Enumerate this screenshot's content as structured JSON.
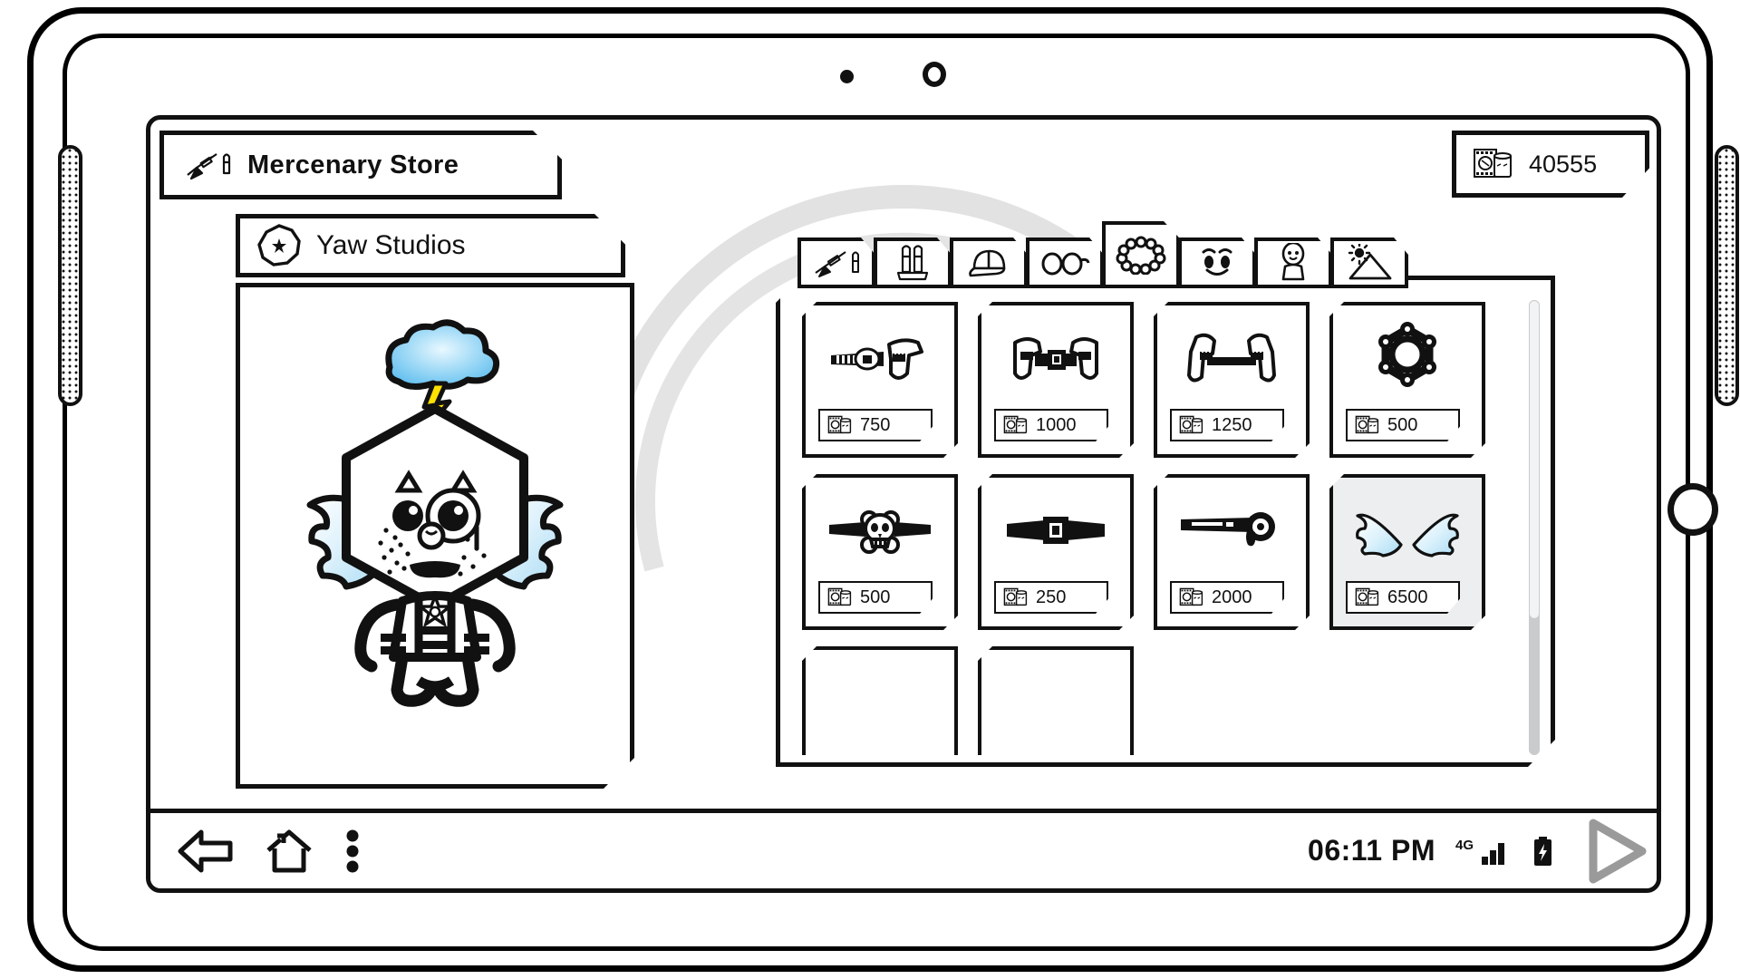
{
  "device": {
    "type": "tablet",
    "front_camera_icon": "camera-ring",
    "front_sensor_icon": "sensor-dot",
    "speaker_icon": "speaker-grille",
    "home_button_icon": "home-button-circle"
  },
  "header": {
    "title": "Mercenary Store",
    "title_icon": "rifle-bullet-icon",
    "currency": {
      "amount": "40555",
      "icon": "film-canister-icon"
    }
  },
  "studio": {
    "name": "Yaw Studios",
    "badge_icon": "nonagon-star-icon"
  },
  "character": {
    "name": "player-avatar",
    "head_shape": "hexagon",
    "mood_icon": "storm-cloud-lightning-icon",
    "eyewear": "monocle",
    "wings": "angel-wings",
    "chest_badge": "sheriff-star",
    "colors": {
      "cloud_fill": "#8fd4f5",
      "cloud_highlight": "#d8f1fd",
      "lightning": "#ffe000",
      "wing_fill": "#d9f1fc",
      "outline": "#111111"
    }
  },
  "tabs": [
    {
      "id": "weapons",
      "icon": "rifle-bullet-icon",
      "active": false
    },
    {
      "id": "ammo",
      "icon": "bullets-icon",
      "active": false
    },
    {
      "id": "headwear",
      "icon": "cap-icon",
      "active": false
    },
    {
      "id": "eyewear",
      "icon": "glasses-icon",
      "active": false
    },
    {
      "id": "accessories",
      "icon": "beads-necklace-icon",
      "active": true
    },
    {
      "id": "face",
      "icon": "face-icon",
      "active": false
    },
    {
      "id": "body",
      "icon": "body-icon",
      "active": false
    },
    {
      "id": "scenery",
      "icon": "landscape-sun-icon",
      "active": false
    }
  ],
  "store": {
    "currency_icon": "film-canister-icon",
    "scroll": {
      "thumb_percent": 70
    },
    "items": [
      {
        "id": "item-1",
        "icon": "holster-belt-single-icon",
        "price": "750",
        "selected": false
      },
      {
        "id": "item-2",
        "icon": "holster-belt-dual-icon",
        "price": "1000",
        "selected": false
      },
      {
        "id": "item-3",
        "icon": "holster-belt-cross-icon",
        "price": "1250",
        "selected": false
      },
      {
        "id": "item-4",
        "icon": "sheriff-star-badge-icon",
        "price": "500",
        "selected": false
      },
      {
        "id": "item-5",
        "icon": "skull-belt-icon",
        "price": "500",
        "selected": false
      },
      {
        "id": "item-6",
        "icon": "plain-belt-icon",
        "price": "250",
        "selected": false
      },
      {
        "id": "item-7",
        "icon": "utility-belt-icon",
        "price": "2000",
        "selected": false
      },
      {
        "id": "item-8",
        "icon": "angel-wings-icon",
        "price": "6500",
        "selected": true
      },
      {
        "id": "item-9",
        "icon": "clipped-row-item",
        "price": "",
        "selected": false
      },
      {
        "id": "item-10",
        "icon": "clipped-row-item",
        "price": "",
        "selected": false
      }
    ]
  },
  "navbar": {
    "back_icon": "back-arrow-icon",
    "home_icon": "home-icon",
    "menu_icon": "three-dot-menu-icon",
    "play_icon": "play-triangle-icon"
  },
  "status": {
    "time": "06:11 PM",
    "network": "4G",
    "signal_icon": "signal-bars-icon",
    "battery_icon": "battery-charging-icon"
  }
}
